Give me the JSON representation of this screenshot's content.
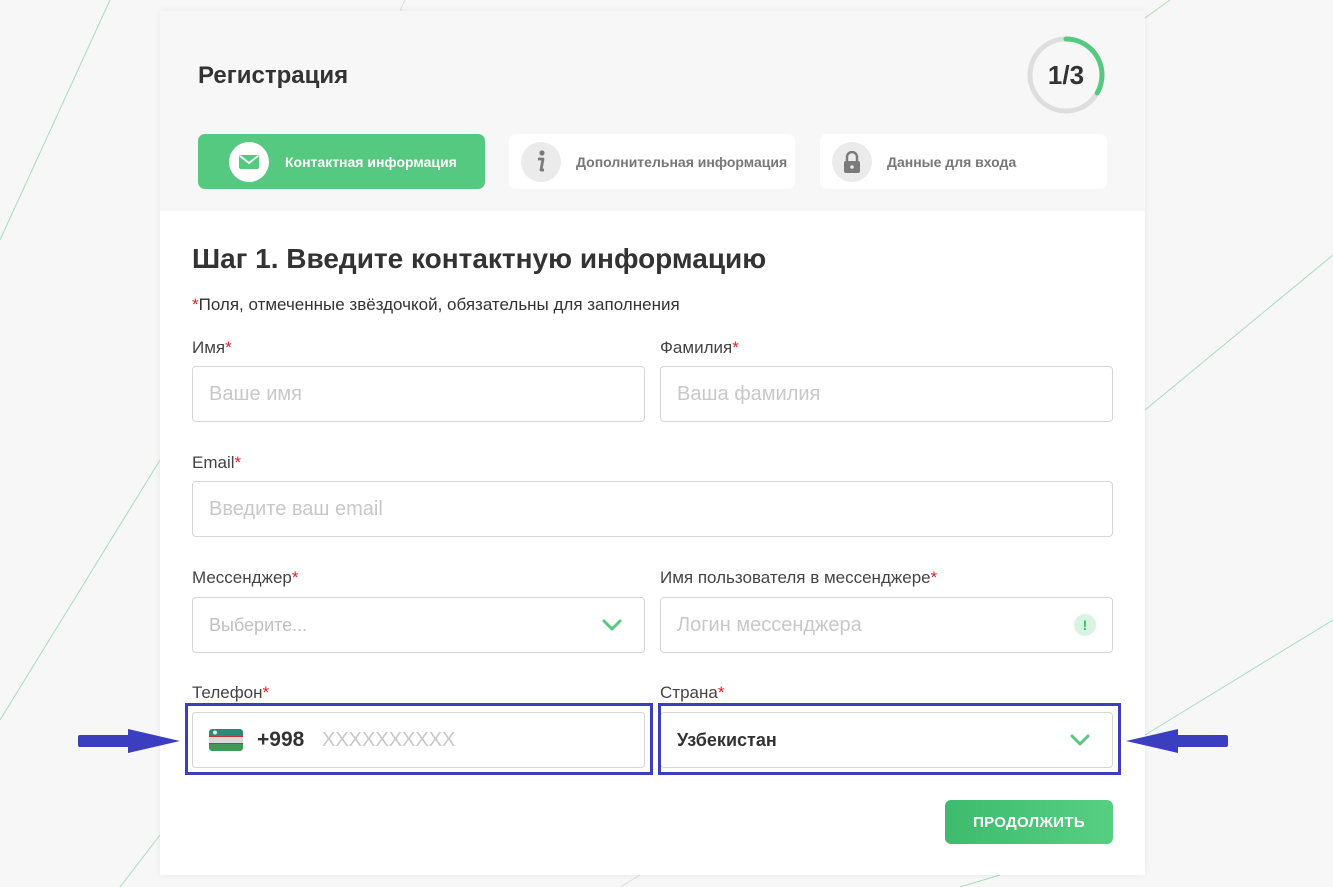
{
  "header": {
    "title": "Регистрация",
    "progress_text": "1/3",
    "progress_fraction": 0.333
  },
  "steps": [
    {
      "label": "Контактная информация",
      "icon": "envelope-icon",
      "active": true
    },
    {
      "label": "Дополнительная информация",
      "icon": "info-icon",
      "active": false
    },
    {
      "label": "Данные для входа",
      "icon": "lock-icon",
      "active": false
    }
  ],
  "form": {
    "title": "Шаг 1. Введите контактную информацию",
    "required_note_star": "*",
    "required_note": "Поля, отмеченные звёздочкой, обязательны для заполнения",
    "star": "*",
    "first_name": {
      "label": "Имя",
      "placeholder": "Ваше имя"
    },
    "last_name": {
      "label": "Фамилия",
      "placeholder": "Ваша фамилия"
    },
    "email": {
      "label": "Email",
      "placeholder": "Введите ваш email"
    },
    "messenger": {
      "label": "Мессенджер",
      "placeholder": "Выберите..."
    },
    "messenger_user": {
      "label": "Имя пользователя в мессенджере",
      "placeholder": "Логин мессенджера",
      "warning_symbol": "!"
    },
    "phone": {
      "label": "Телефон",
      "prefix": "+998",
      "placeholder": "XXXXXXXXXX",
      "flag": "uzbekistan-flag-icon"
    },
    "country": {
      "label": "Страна",
      "value": "Узбекистан"
    },
    "submit_label": "ПРОДОЛЖИТЬ"
  },
  "colors": {
    "accent": "#55c97f",
    "required_star": "#e0202a",
    "highlight": "#3b3fbf"
  }
}
